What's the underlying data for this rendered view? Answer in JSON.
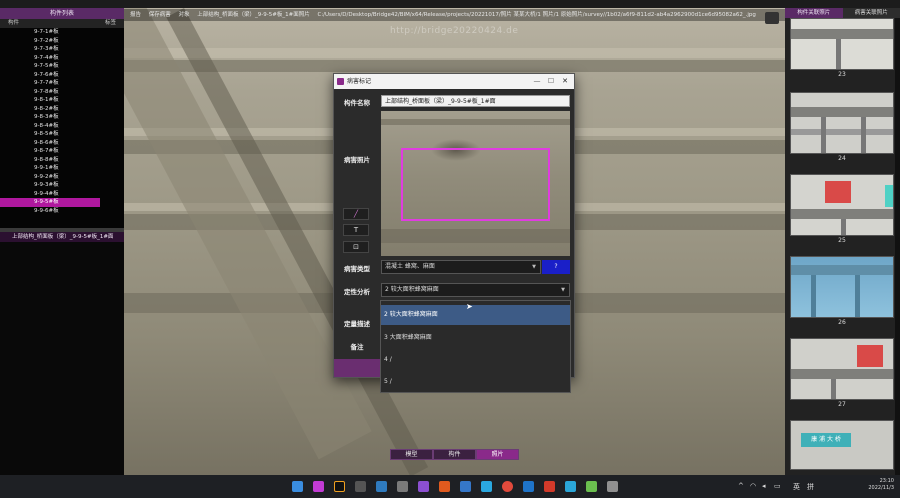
{
  "window": {
    "path_items": [
      "报告",
      "保存病害",
      "对象",
      "上部结构_桥面板（梁）_9-9-5#板_1#面照片",
      "C:/Users/D/Desktop/Bridge42/BIM/x64/Release/projects/20221017/照片 某某大桥/1 照片/1 原始照片/survey//1b02/a6f9-811d2-ab4a2962900d1ce6d95082a62_.jpg"
    ],
    "watermark": "http://bridge20220424.de"
  },
  "left_panel": {
    "header": "构件列表",
    "col_component": "构件",
    "col_label": "标签",
    "items": [
      "9-7-1#板",
      "9-7-2#板",
      "9-7-3#板",
      "9-7-4#板",
      "9-7-5#板",
      "9-7-6#板",
      "9-7-7#板",
      "9-7-8#板",
      "9-8-1#板",
      "9-8-2#板",
      "9-8-3#板",
      "9-8-4#板",
      "9-8-5#板",
      "9-8-6#板",
      "9-8-7#板",
      "9-8-8#板",
      "9-9-1#板",
      "9-9-2#板",
      "9-9-3#板",
      "9-9-4#板",
      "9-9-5#板",
      "9-9-6#板"
    ],
    "selected_index": 20,
    "selected_face": "上部结构_桥面板（梁）_9-9-5#板_1#面"
  },
  "right_panel": {
    "tab_component_photos": "构件关联照片",
    "tab_disease_photos": "病害关联照片",
    "thumb_numbers": [
      "23",
      "24",
      "25",
      "26",
      "27"
    ],
    "last_thumb_sign": "康 浦 大 桥"
  },
  "dialog": {
    "title": "病害标记",
    "component_name_label": "构件名称",
    "component_name": "上部结构_桥面板（梁）_9-9-5#板_1#面",
    "photo_label": "病害照片",
    "tool_pen": "╱",
    "tool_text": "T",
    "tool_rect": "⊡",
    "disease_type_label": "病害类型",
    "disease_type": "混凝土  蜂窝、麻面",
    "help_button": "?",
    "qualitative_label": "定性分析",
    "qualitative_value": "2 较大面积蜂窝麻面",
    "quantitative_label": "定量描述",
    "remark_label": "备注"
  },
  "dropdown": {
    "options": [
      "2 较大面积蜂窝麻面",
      "3 大面积蜂窝麻面",
      "4 /",
      "5 /"
    ],
    "highlighted_index": 0
  },
  "bottom_tabs": {
    "model": "模型",
    "component": "构件",
    "photo": "照片",
    "active": "photo"
  },
  "taskbar": {
    "lang": "英",
    "ime": "拼",
    "time": "23:10",
    "date": "2022/11/3"
  },
  "colors": {
    "accent": "#8a2a8a",
    "selection": "#b0189f",
    "highlight": "#3d5b86",
    "damage_box": "#e03ce0"
  }
}
